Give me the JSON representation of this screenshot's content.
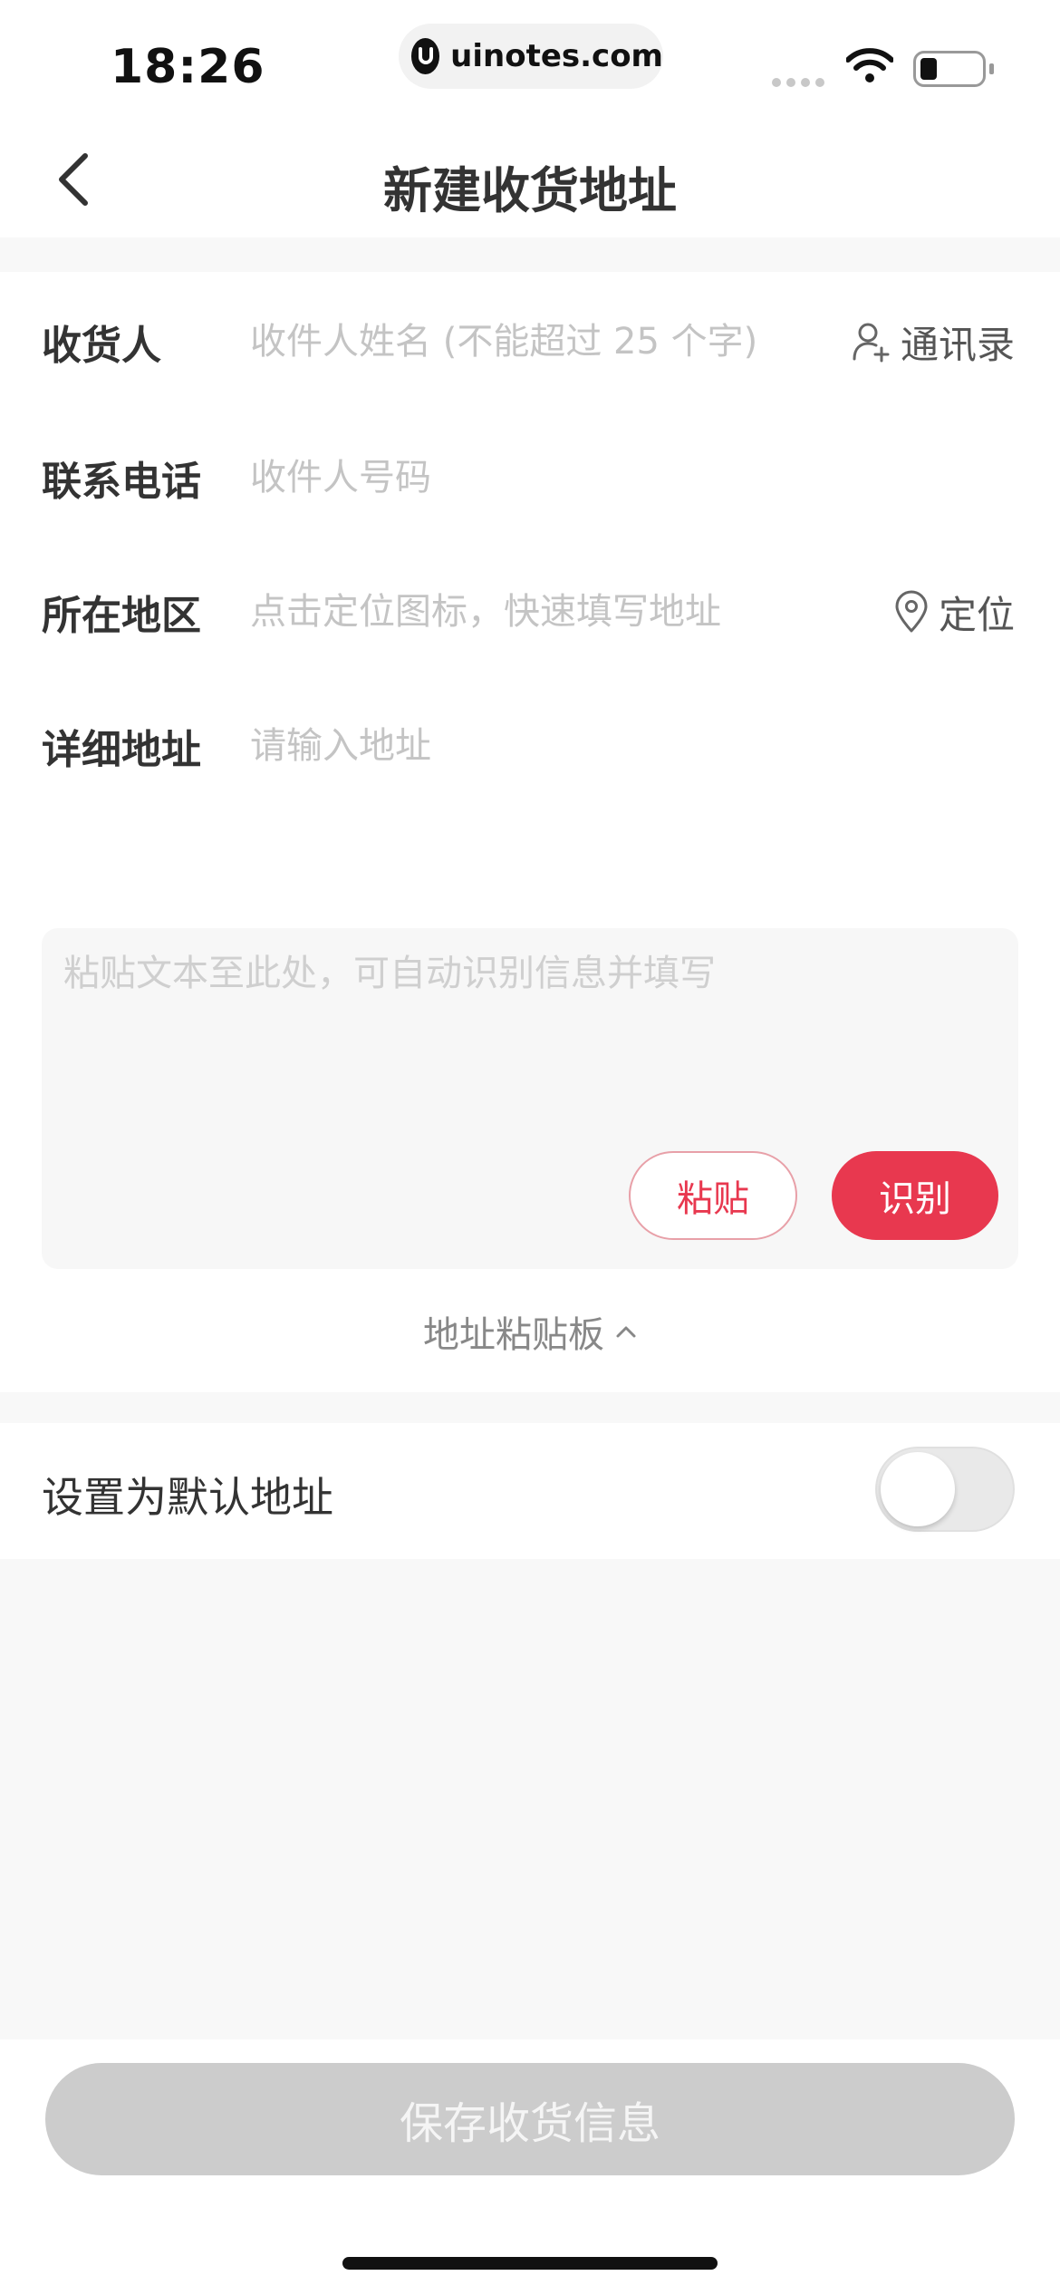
{
  "status_bar": {
    "time": "18:26",
    "url": "uinotes.com"
  },
  "nav": {
    "title": "新建收货地址",
    "back_icon": "chevron-left-icon"
  },
  "form": {
    "receiver": {
      "label": "收货人",
      "placeholder": "收件人姓名 (不能超过 25 个字)",
      "value": "",
      "action_label": "通讯录",
      "action_icon": "person-add-icon"
    },
    "phone": {
      "label": "联系电话",
      "placeholder": "收件人号码",
      "value": ""
    },
    "region": {
      "label": "所在地区",
      "placeholder": "点击定位图标，快速填写地址",
      "value": "",
      "action_label": "定位",
      "action_icon": "location-pin-icon"
    },
    "detail": {
      "label": "详细地址",
      "placeholder": "请输入地址",
      "value": ""
    }
  },
  "paste_area": {
    "placeholder": "粘贴文本至此处，可自动识别信息并填写",
    "value": "",
    "paste_label": "粘贴",
    "recognize_label": "识别",
    "clipboard_label": "地址粘贴板"
  },
  "default_setting": {
    "label": "设置为默认地址",
    "enabled": false
  },
  "save_button": {
    "label": "保存收货信息",
    "enabled": false
  },
  "colors": {
    "accent": "#e8384f",
    "disabled_button": "#cccccc",
    "placeholder": "#c4c4c4"
  }
}
